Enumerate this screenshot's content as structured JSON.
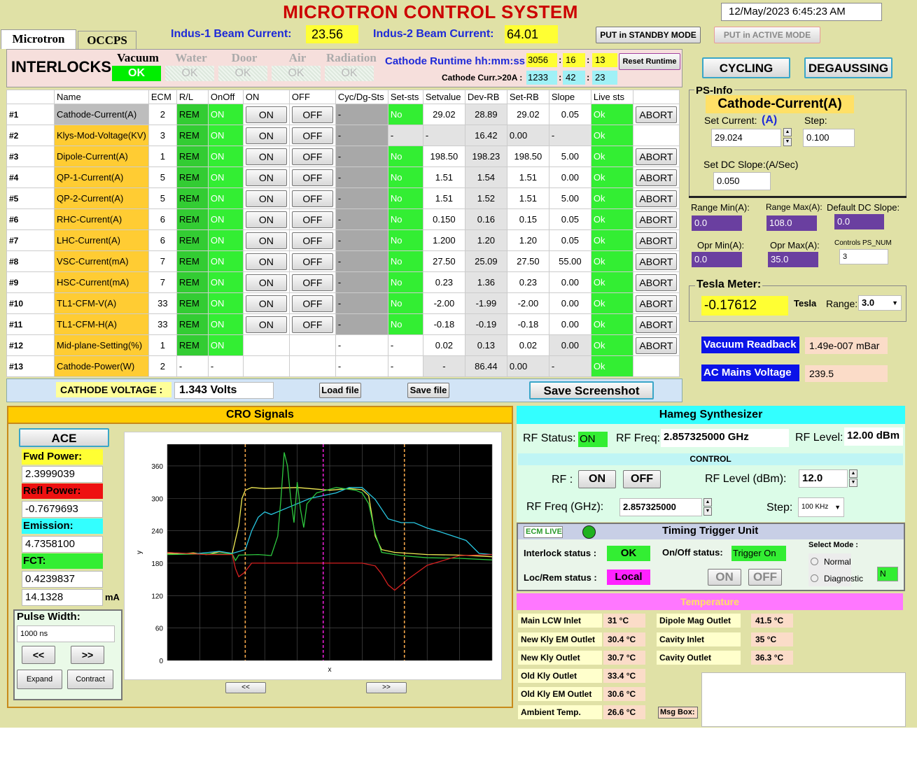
{
  "title": "MICROTRON CONTROL SYSTEM",
  "datetime": "12/May/2023    6:45:23  AM",
  "tabs": [
    "Microtron",
    "OCCPS"
  ],
  "beam": {
    "indus1_label": "Indus-1 Beam Current:",
    "indus1_value": "23.56",
    "indus2_label": "Indus-2 Beam Current:",
    "indus2_value": "64.01"
  },
  "mode_buttons": {
    "standby": "PUT in STANDBY MODE",
    "active": "PUT in ACTIVE MODE"
  },
  "interlocks": {
    "title": "INTERLOCKS",
    "items": [
      {
        "label": "Vacuum",
        "status": "OK"
      },
      {
        "label": "Water",
        "status": "OK"
      },
      {
        "label": "Door",
        "status": "OK"
      },
      {
        "label": "Air",
        "status": "OK"
      },
      {
        "label": "Radiation",
        "status": "OK"
      }
    ]
  },
  "runtime": {
    "label": "Cathode Runtime hh:mm:ss",
    "h": "3056",
    "m": "16",
    "s": "13",
    "reset": "Reset Runtime",
    "curr_label": "Cathode Curr.>20A :",
    "ch": "1233",
    "cm": "42",
    "cs": "23"
  },
  "table": {
    "headers": [
      "",
      "Name",
      "ECM",
      "R/L",
      "OnOff",
      "ON",
      "OFF",
      "Cyc/Dg-Sts",
      "Set-sts",
      "Setvalue",
      "Dev-RB",
      "Set-RB",
      "Slope",
      "Live  sts",
      ""
    ],
    "on_label": "ON",
    "off_label": "OFF",
    "abort_label": "ABORT",
    "rows": [
      {
        "idx": "#1",
        "name": "Cathode-Current(A)",
        "ecm": "2",
        "rl": "REM",
        "onoff": "ON",
        "btns": true,
        "cyc": "-",
        "setsts": "No",
        "setvalue": "29.02",
        "devrb": "28.89",
        "setrb": "29.02",
        "slope": "0.05",
        "live": "Ok",
        "abort": true
      },
      {
        "idx": "#2",
        "name": "Klys-Mod-Voltage(KV)",
        "ecm": "3",
        "rl": "REM",
        "onoff": "ON",
        "btns": true,
        "cyc": "-",
        "setsts": "-",
        "setvalue": "-",
        "devrb": "16.42",
        "setrb": "0.00",
        "slope": "-",
        "live": "Ok",
        "abort": false
      },
      {
        "idx": "#3",
        "name": "Dipole-Current(A)",
        "ecm": "1",
        "rl": "REM",
        "onoff": "ON",
        "btns": true,
        "cyc": "-",
        "setsts": "No",
        "setvalue": "198.50",
        "devrb": "198.23",
        "setrb": "198.50",
        "slope": "5.00",
        "live": "Ok",
        "abort": true
      },
      {
        "idx": "#4",
        "name": "QP-1-Current(A)",
        "ecm": "5",
        "rl": "REM",
        "onoff": "ON",
        "btns": true,
        "cyc": "-",
        "setsts": "No",
        "setvalue": "1.51",
        "devrb": "1.54",
        "setrb": "1.51",
        "slope": "0.00",
        "live": "Ok",
        "abort": true
      },
      {
        "idx": "#5",
        "name": "QP-2-Current(A)",
        "ecm": "5",
        "rl": "REM",
        "onoff": "ON",
        "btns": true,
        "cyc": "-",
        "setsts": "No",
        "setvalue": "1.51",
        "devrb": "1.52",
        "setrb": "1.51",
        "slope": "5.00",
        "live": "Ok",
        "abort": true
      },
      {
        "idx": "#6",
        "name": "RHC-Current(A)",
        "ecm": "6",
        "rl": "REM",
        "onoff": "ON",
        "btns": true,
        "cyc": "-",
        "setsts": "No",
        "setvalue": "0.150",
        "devrb": "0.16",
        "setrb": "0.15",
        "slope": "0.05",
        "live": "Ok",
        "abort": true
      },
      {
        "idx": "#7",
        "name": "LHC-Current(A)",
        "ecm": "6",
        "rl": "REM",
        "onoff": "ON",
        "btns": true,
        "cyc": "-",
        "setsts": "No",
        "setvalue": "1.200",
        "devrb": "1.20",
        "setrb": "1.20",
        "slope": "0.05",
        "live": "Ok",
        "abort": true
      },
      {
        "idx": "#8",
        "name": "VSC-Current(mA)",
        "ecm": "7",
        "rl": "REM",
        "onoff": "ON",
        "btns": true,
        "cyc": "-",
        "setsts": "No",
        "setvalue": "27.50",
        "devrb": "25.09",
        "setrb": "27.50",
        "slope": "55.00",
        "live": "Ok",
        "abort": true
      },
      {
        "idx": "#9",
        "name": "HSC-Current(mA)",
        "ecm": "7",
        "rl": "REM",
        "onoff": "ON",
        "btns": true,
        "cyc": "-",
        "setsts": "No",
        "setvalue": "0.23",
        "devrb": "1.36",
        "setrb": "0.23",
        "slope": "0.00",
        "live": "Ok",
        "abort": true
      },
      {
        "idx": "#10",
        "name": "TL1-CFM-V(A)",
        "ecm": "33",
        "rl": "REM",
        "onoff": "ON",
        "btns": true,
        "cyc": "-",
        "setsts": "No",
        "setvalue": "-2.00",
        "devrb": "-1.99",
        "setrb": "-2.00",
        "slope": "0.00",
        "live": "Ok",
        "abort": true
      },
      {
        "idx": "#11",
        "name": "TL1-CFM-H(A)",
        "ecm": "33",
        "rl": "REM",
        "onoff": "ON",
        "btns": true,
        "cyc": "-",
        "setsts": "No",
        "setvalue": "-0.18",
        "devrb": "-0.19",
        "setrb": "-0.18",
        "slope": "0.00",
        "live": "Ok",
        "abort": true
      },
      {
        "idx": "#12",
        "name": "Mid-plane-Setting(%)",
        "ecm": "1",
        "rl": "REM",
        "onoff": "ON",
        "btns": false,
        "cyc": "-",
        "setsts": "-",
        "setvalue": "0.02",
        "devrb": "0.13",
        "setrb": "0.02",
        "slope": "0.00",
        "live": "Ok",
        "abort": true
      },
      {
        "idx": "#13",
        "name": "Cathode-Power(W)",
        "ecm": "2",
        "rl": "-",
        "onoff": "-",
        "btns": false,
        "cyc": "-",
        "setsts": "-",
        "setvalue": "-",
        "devrb": "86.44",
        "setrb": "0.00",
        "slope": "-",
        "live": "Ok",
        "abort": false
      }
    ]
  },
  "cathode": {
    "label": "CATHODE VOLTAGE :",
    "value": "1.343  Volts",
    "load": "Load file",
    "save": "Save file",
    "screenshot": "Save Screenshot"
  },
  "right": {
    "cycling": "CYCLING",
    "degaussing": "DEGAUSSING",
    "psinfo": "PS-Info",
    "ps_name": "Cathode-Current(A)",
    "set_current_label": "Set Current:",
    "unit": "(A)",
    "step_label": "Step:",
    "set_current": "29.024",
    "step": "0.100",
    "slope_label": "Set DC Slope:(A/Sec)",
    "slope": "0.050",
    "range_min_label": "Range Min(A):",
    "range_max_label": "Range Max(A):",
    "def_slope_label": "Default DC Slope:",
    "range_min": "0.0",
    "range_max": "108.0",
    "def_slope": "0.0",
    "opr_min_label": "Opr Min(A):",
    "opr_max_label": "Opr Max(A):",
    "ps_num_label": "Controls PS_NUM",
    "opr_min": "0.0",
    "opr_max": "35.0",
    "ps_num": "3",
    "tesla_title": "Tesla Meter:",
    "tesla_value": "-0.17612",
    "tesla_unit": "Tesla",
    "range_label": "Range:",
    "range_value": "3.0",
    "vacuum_label": "Vacuum Readback",
    "vacuum_value": "1.49e-007 mBar",
    "ac_label": "AC Mains Voltage",
    "ac_value": "239.5"
  },
  "cro": {
    "title": "CRO Signals",
    "ace": "ACE",
    "fwd_label": "Fwd Power:",
    "fwd": "2.3999039",
    "refl_label": "Refl Power:",
    "refl": "-0.7679693",
    "emis_label": "Emission:",
    "emis": "4.7358100",
    "fct_label": "FCT:",
    "fct": "0.4239837",
    "ma_value": "14.1328",
    "ma_unit": "mA",
    "pulse_label": "Pulse Width:",
    "pulse": "1000 ns",
    "prev": "<<",
    "next": ">>",
    "expand": "Expand",
    "contract": "Contract",
    "scroll_left": "<<",
    "scroll_right": ">>"
  },
  "chart_data": {
    "type": "line",
    "xlabel": "x",
    "ylabel": "y",
    "ylim": [
      0,
      400
    ],
    "yticks": [
      0,
      60,
      120,
      180,
      240,
      300,
      360
    ],
    "grid": true,
    "series": [
      {
        "color": "#f2ec55",
        "x": [
          0,
          20,
          40,
          60,
          80,
          100,
          110,
          115,
          120,
          130,
          150,
          200,
          250,
          280,
          300,
          310,
          320,
          330,
          350,
          400,
          450,
          500
        ],
        "values": [
          198,
          197,
          199,
          196,
          201,
          198,
          250,
          300,
          315,
          320,
          318,
          320,
          315,
          318,
          316,
          305,
          230,
          205,
          200,
          196,
          195,
          192
        ]
      },
      {
        "color": "#28c6e0",
        "x": [
          0,
          40,
          80,
          100,
          120,
          130,
          140,
          150,
          160,
          180,
          220,
          260,
          280,
          300,
          320,
          340,
          360,
          380,
          400,
          420,
          440,
          460,
          480,
          500
        ],
        "values": [
          200,
          197,
          202,
          198,
          205,
          240,
          265,
          275,
          270,
          280,
          300,
          310,
          320,
          320,
          298,
          262,
          255,
          255,
          245,
          238,
          230,
          222,
          198,
          196
        ]
      },
      {
        "color": "#2ec83f",
        "x": [
          0,
          60,
          100,
          105,
          110,
          140,
          160,
          170,
          175,
          180,
          185,
          190,
          195,
          200,
          205,
          210,
          215,
          230,
          260,
          290,
          300,
          310,
          320,
          330,
          360,
          400,
          450,
          500
        ],
        "values": [
          196,
          197,
          197,
          185,
          195,
          196,
          194,
          230,
          300,
          385,
          360,
          300,
          255,
          330,
          280,
          246,
          290,
          310,
          320,
          315,
          310,
          290,
          235,
          200,
          194,
          190,
          189,
          186
        ]
      },
      {
        "color": "#d42020",
        "x": [
          0,
          60,
          100,
          105,
          110,
          118,
          130,
          200,
          250,
          300,
          320,
          330,
          340,
          350,
          370,
          400,
          450,
          500
        ],
        "values": [
          200,
          196,
          196,
          170,
          155,
          162,
          180,
          180,
          180,
          180,
          175,
          160,
          140,
          130,
          150,
          176,
          194,
          196
        ]
      }
    ],
    "vlines": [
      {
        "x": 120,
        "color": "#f2a54a"
      },
      {
        "x": 240,
        "color": "#e61ed2"
      },
      {
        "x": 365,
        "color": "#f2a54a"
      }
    ]
  },
  "hameg": {
    "title": "Hameg Synthesizer",
    "rf_status_label": "RF Status:",
    "rf_status": "ON",
    "rf_freq_label": "RF Freq:",
    "rf_freq": "2.857325000 GHz",
    "rf_level_label": "RF Level:",
    "rf_level": "12.00 dBm",
    "control": "CONTROL",
    "rf_label": "RF :",
    "on": "ON",
    "off": "OFF",
    "level_in_label": "RF Level (dBm):",
    "level_in": "12.0",
    "freq_in_label": "RF Freq (GHz):",
    "freq_in": "2.857325000",
    "step_label": "Step:",
    "step": "100 KHz"
  },
  "timing": {
    "ecm": "ECM LIVE",
    "title": "Timing Trigger Unit",
    "interlock_label": "Interlock status :",
    "interlock": "OK",
    "onoff_label": "On/Off status:",
    "onoff": "Trigger On",
    "locrem_label": "Loc/Rem status :",
    "locrem": "Local",
    "on": "ON",
    "off": "OFF",
    "mode_label": "Select Mode :",
    "normal": "Normal",
    "diagnostic": "Diagnostic",
    "n": "N"
  },
  "temperature": {
    "title": "Temperature",
    "left": [
      {
        "label": "Main LCW Inlet",
        "value": "31 °C"
      },
      {
        "label": "New Kly EM Outlet",
        "value": "30.4 °C"
      },
      {
        "label": "New Kly Outlet",
        "value": "30.7 °C"
      },
      {
        "label": "Old Kly Outlet",
        "value": "33.4 °C"
      },
      {
        "label": "Old Kly EM Outlet",
        "value": "30.6 °C"
      },
      {
        "label": "Ambient Temp.",
        "value": "26.6 °C"
      }
    ],
    "right": [
      {
        "label": "Dipole Mag Outlet",
        "value": "41.5 °C"
      },
      {
        "label": "Cavity Inlet",
        "value": "35 °C"
      },
      {
        "label": "Cavity Outlet",
        "value": "36.3 °C"
      }
    ],
    "msg": "Msg Box:"
  },
  "colors": {
    "background": "#e0e1a6",
    "title": "#cc0000",
    "green": "#33ee33",
    "orange": "#ffcc33",
    "yellow": "#ffff33",
    "cyan": "#33ffff",
    "magenta": "#ff66ff",
    "blue": "#0b13e8"
  }
}
